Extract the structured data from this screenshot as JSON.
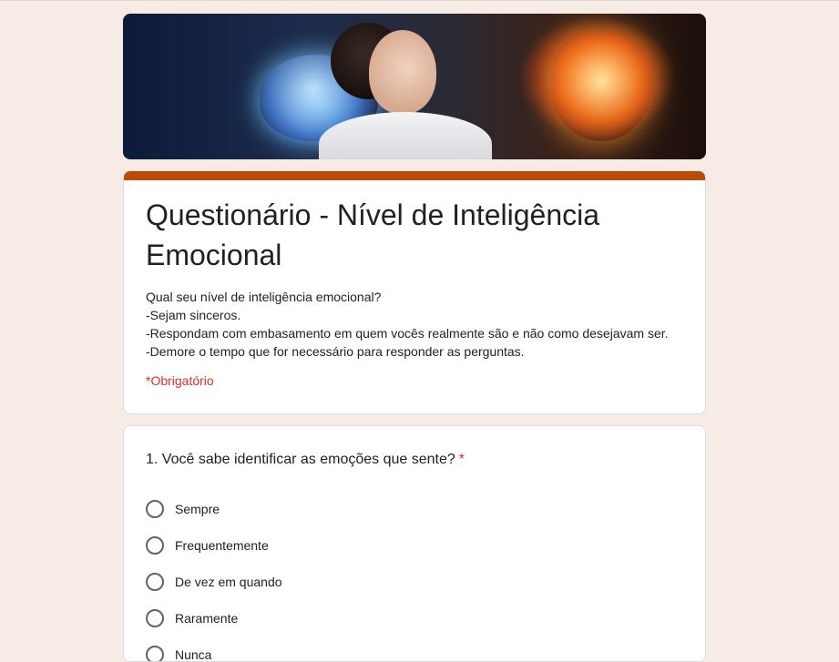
{
  "form": {
    "title": "Questionário - Nível de Inteligência Emocional",
    "description_lines": [
      "Qual seu nível de inteligência emocional?",
      "-Sejam sinceros.",
      "-Respondam com embasamento em quem vocês realmente são e não como desejavam ser.",
      "-Demore o tempo que for necessário para responder as perguntas."
    ],
    "required_note": "*Obrigatório",
    "accent_color": "#b94c09",
    "background_color": "#f6ebe5"
  },
  "question1": {
    "title": "1. Você sabe identificar as emoções que sente?",
    "required_marker": "*",
    "options": [
      "Sempre",
      "Frequentemente",
      "De vez em quando",
      "Raramente",
      "Nunca"
    ]
  }
}
